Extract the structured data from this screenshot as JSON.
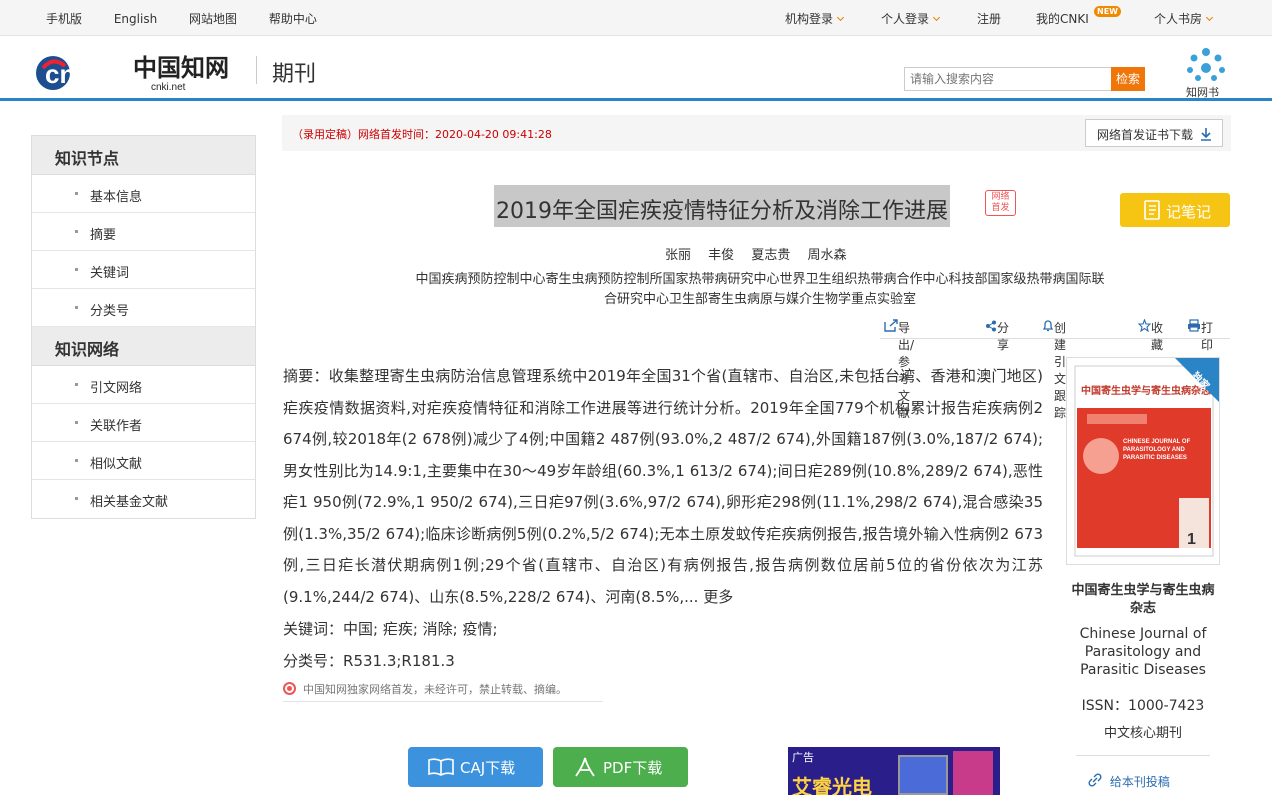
{
  "topbar": {
    "left_links": [
      "手机版",
      "English",
      "网站地图",
      "帮助中心"
    ],
    "inst_login": "机构登录",
    "personal_login": "个人登录",
    "register": "注册",
    "my_cnki": "我的CNKI",
    "new_badge": "NEW",
    "personal_study": "个人书房"
  },
  "header": {
    "logo_text": "cnki",
    "logo_cn": "中国知网",
    "logo_sub": "cnki.net",
    "section": "期刊",
    "search_placeholder": "请输入搜索内容",
    "search_button": "检索",
    "zsb_label": "知网书"
  },
  "sidebar": {
    "sections": [
      {
        "title": "知识节点",
        "items": [
          "基本信息",
          "摘要",
          "关键词",
          "分类号"
        ]
      },
      {
        "title": "知识网络",
        "items": [
          "引文网络",
          "关联作者",
          "相似文献",
          "相关基金文献"
        ]
      }
    ]
  },
  "notice": {
    "text": "（录用定稿）网络首发时间：2020-04-20 09:41:28",
    "cert_button": "网络首发证书下载"
  },
  "article": {
    "title": "2019年全国疟疾疫情特征分析及消除工作进展",
    "first_pub_badge_1": "网络",
    "first_pub_badge_2": "首发",
    "note_button": "记笔记",
    "authors": [
      "张丽",
      "丰俊",
      "夏志贵",
      "周水森"
    ],
    "affiliation_1": "中国疾病预防控制中心寄生虫病预防控制所国家热带病研究中心世界卫生组织热带病合作中心科技部国家级热带病国际联",
    "affiliation_2": "合研究中心卫生部寄生虫病原与媒介生物学重点实验室",
    "tools": [
      "导出/参考文献",
      "分享",
      "创建引文跟踪",
      "收藏",
      "打印"
    ],
    "abstract_label": "摘要：",
    "abstract": "收集整理寄生虫病防治信息管理系统中2019年全国31个省(直辖市、自治区,未包括台湾、香港和澳门地区)疟疾疫情数据资料,对疟疾疫情特征和消除工作进展等进行统计分析。2019年全国779个机构累计报告疟疾病例2 674例,较2018年(2 678例)减少了4例;中国籍2 487例(93.0%,2 487/2 674),外国籍187例(3.0%,187/2 674);男女性别比为14.9:1,主要集中在30～49岁年龄组(60.3%,1 613/2 674);间日疟289例(10.8%,289/2 674),恶性疟1 950例(72.9%,1 950/2 674),三日疟97例(3.6%,97/2 674),卵形疟298例(11.1%,298/2 674),混合感染35例(1.3%,35/2 674);临床诊断病例5例(0.2%,5/2 674);无本土原发蚊传疟疾病例报告,报告境外输入性病例2 673例,三日疟长潜伏期病例1例;29个省(直辖市、自治区)有病例报告,报告病例数位居前5位的省份依次为江苏(9.1%,244/2 674)、山东(8.5%,228/2 674)、河南(8.5%,...",
    "more": "更多",
    "keywords_label": "关键词：",
    "keywords": "中国; 疟疾; 消除; 疫情;",
    "class_label": "分类号：",
    "class_no": "R531.3;R181.3",
    "copyright": "中国知网独家网络首发，未经许可，禁止转载、摘编。"
  },
  "downloads": {
    "caj": "CAJ下载",
    "pdf": "PDF下载"
  },
  "ad": {
    "tag": "广告",
    "brand": "艾睿光电"
  },
  "journal": {
    "exclusive": "独家",
    "name": "中国寄生虫学与寄生虫病杂志",
    "name_en": "Chinese Journal of Parasitology and Parasitic Diseases",
    "cover_title": "中国寄生虫学与寄生虫病杂志",
    "cover_en": "CHINESE JOURNAL OF PARASITOLOGY AND PARASITIC DISEASES",
    "cover_issue": "1",
    "issn": "ISSN：1000-7423",
    "core": "中文核心期刊",
    "submit": "给本刊投稿"
  },
  "colors": {
    "accent": "#2b84c6",
    "search_btn": "#f0760a",
    "note_btn": "#f6c514",
    "caj": "#3c92dc",
    "pdf": "#4cae4c"
  }
}
